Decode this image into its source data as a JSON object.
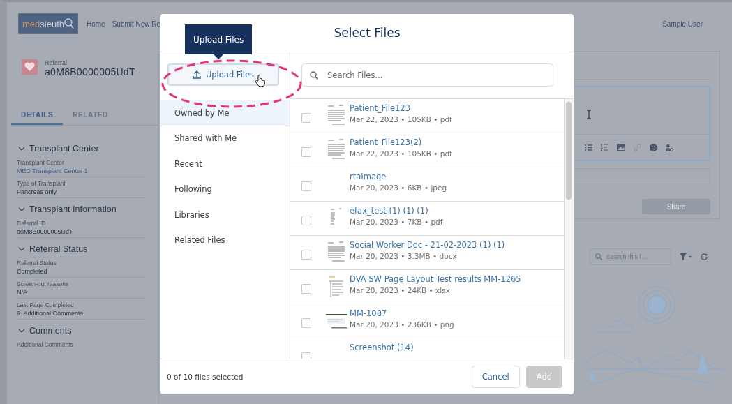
{
  "header": {
    "logo": {
      "part_1": "med",
      "part_2": "sleuth"
    },
    "nav": [
      "Home",
      "Submit New Re"
    ],
    "user": "Sample User"
  },
  "record": {
    "type": "Referral",
    "name": "a0M8B0000005UdT"
  },
  "record_tabs": [
    {
      "label": "DETAILS",
      "selected": true
    },
    {
      "label": "RELATED",
      "selected": false
    }
  ],
  "sections": [
    {
      "title": "Transplant Center",
      "expanded": true,
      "fields": [
        {
          "label": "Transplant Center",
          "value": "MED Transplant Center 1",
          "kind": "link"
        },
        {
          "label": "Type of Transplant",
          "value": "Pancreas only",
          "kind": "text"
        }
      ]
    },
    {
      "title": "Transplant Information",
      "expanded": true,
      "fields": [
        {
          "label": "Referral ID",
          "value": "a0M8B0000005UdT",
          "kind": "text"
        }
      ]
    },
    {
      "title": "Referral Status",
      "expanded": true,
      "fields": [
        {
          "label": "Referral Status",
          "value": "Completed",
          "kind": "text"
        },
        {
          "label": "Screen-out reasons",
          "value": "N/A",
          "kind": "text"
        },
        {
          "label": "Last Page Completed",
          "value": "9. Additional Comments",
          "kind": "text"
        }
      ]
    },
    {
      "title": "Comments",
      "expanded": true,
      "fields": [
        {
          "label": "Additional Comments"
        }
      ]
    }
  ],
  "feed": {
    "share_button": {
      "label": "Share",
      "disabled": true
    },
    "search": {
      "placeholder": "Search this f…"
    }
  },
  "modal": {
    "title": "Select Files",
    "tooltip": "Upload Files",
    "upload_button": "Upload Files",
    "nav": [
      {
        "label": "Owned by Me",
        "selected": true
      },
      {
        "label": "Shared with Me",
        "selected": false
      },
      {
        "label": "Recent",
        "selected": false
      },
      {
        "label": "Following",
        "selected": false
      },
      {
        "label": "Libraries",
        "selected": false
      },
      {
        "label": "Related Files",
        "selected": false
      }
    ],
    "search": {
      "placeholder": "Search Files..."
    },
    "files": [
      {
        "name": "Patient_File123",
        "details": "Mar 22, 2023 • 105KB • pdf",
        "kind": "document",
        "checked": false
      },
      {
        "name": "Patient_File123(2)",
        "details": "Mar 22, 2023 • 105KB • pdf",
        "kind": "document",
        "checked": false
      },
      {
        "name": "rtaImage",
        "details": "Mar 20, 2023 • 6KB • jpeg",
        "kind": "blank",
        "checked": false
      },
      {
        "name": "efax_test (1) (1) (1)",
        "details": "Mar 20, 2023 • 7KB • pdf",
        "kind": "fax",
        "checked": false
      },
      {
        "name": "Social Worker Doc - 21-02-2023 (1) (1)",
        "details": "Mar 20, 2023 • 3.3MB • docx",
        "kind": "document",
        "checked": false
      },
      {
        "name": "DVA SW Page Layout Test results MM-1265",
        "details": "Mar 20, 2023 • 24KB • xlsx",
        "kind": "sheet",
        "checked": false
      },
      {
        "name": "MM-1087",
        "details": "Mar 20, 2023 • 236KB • png",
        "kind": "image",
        "checked": false
      },
      {
        "name": "Screenshot (14)",
        "kind": "blank",
        "checked": false
      }
    ],
    "status": "0 of 10 files selected",
    "buttons": [
      {
        "label": "Cancel",
        "kind": "neutral",
        "disabled": false
      },
      {
        "label": "Add",
        "kind": "brand",
        "disabled": true
      }
    ]
  }
}
